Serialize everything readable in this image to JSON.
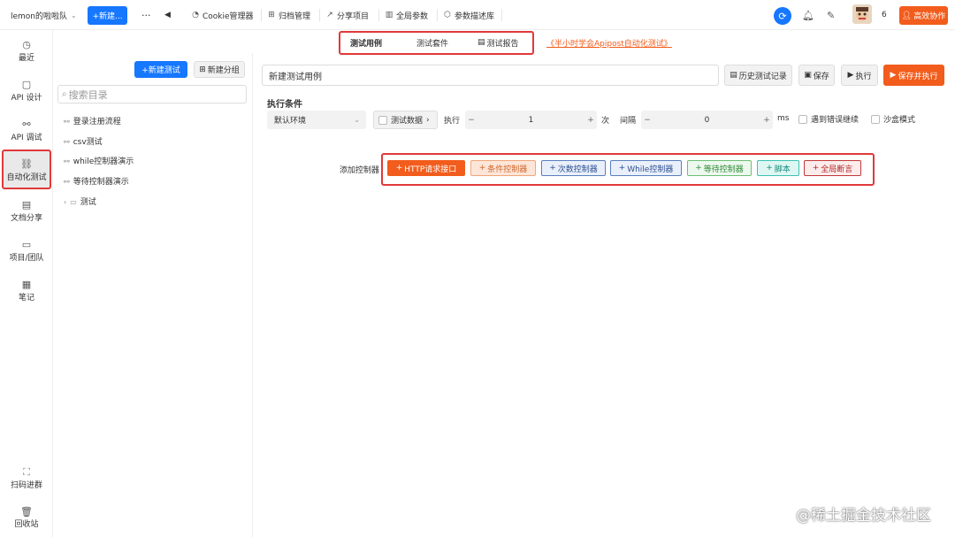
{
  "topbar": {
    "team_name": "lemon的啦啦队",
    "new_button": "+新建...",
    "more": "···",
    "menu": [
      "Cookie管理器",
      "归档管理",
      "分享项目",
      "全局参数",
      "参数描述库"
    ],
    "notification_count": "6",
    "collab_button": "高效协作"
  },
  "leftnav": {
    "items": [
      "最近",
      "API 设计",
      "API 调试",
      "自动化测试",
      "文档分享",
      "项目/团队",
      "笔记"
    ],
    "bottom": [
      "扫码进群",
      "回收站"
    ]
  },
  "tabs": {
    "items": [
      "测试用例",
      "测试套件",
      "测试报告"
    ],
    "link": "《半小时学会Apipost自动化测试》"
  },
  "directory": {
    "new_test": "+新建测试",
    "new_group": "新建分组",
    "search_placeholder": "搜索目录",
    "items": [
      "登录注册流程",
      "csv测试",
      "while控制器演示",
      "等待控制器演示",
      "测试"
    ]
  },
  "editor": {
    "name": "新建测试用例",
    "history": "历史测试记录",
    "save": "保存",
    "execute": "执行",
    "save_execute": "保存并执行"
  },
  "conditions": {
    "title": "执行条件",
    "environment": "默认环境",
    "test_data": "测试数据",
    "execute_label": "执行",
    "times_value": "1",
    "times_unit": "次",
    "interval_label": "间隔",
    "interval_value": "0",
    "interval_unit": "ms",
    "continue_on_error": "遇到错误继续",
    "sandbox": "沙盒模式"
  },
  "controllers": {
    "label": "添加控制器",
    "items": [
      "HTTP请求接口",
      "条件控制器",
      "次数控制器",
      "While控制器",
      "等待控制器",
      "脚本",
      "全局断言"
    ]
  },
  "watermark": "@稀土掘金技术社区",
  "colors": {
    "primary": "#1677ff",
    "accent": "#f25c1c",
    "highlight": "#e0393a"
  }
}
